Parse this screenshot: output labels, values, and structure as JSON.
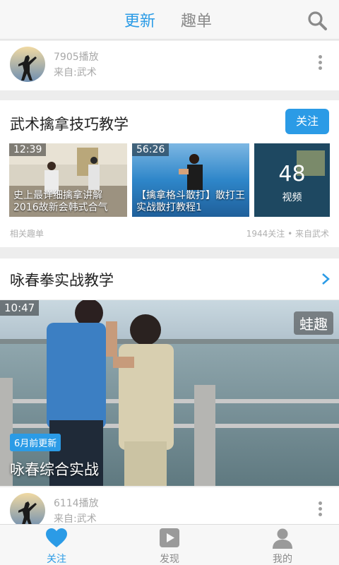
{
  "header": {
    "tabs": [
      {
        "label": "更新",
        "active": true
      },
      {
        "label": "趣单",
        "active": false
      }
    ],
    "search_icon": "search-icon",
    "accent_color": "#2b9be6"
  },
  "feed_top": {
    "plays": "7905播放",
    "source": "来自:武术"
  },
  "series": {
    "title": "武术擒拿技巧教学",
    "follow_label": "关注",
    "videos": [
      {
        "duration": "12:39",
        "caption": "史上最详细擒拿讲解2016故新会韩式合气"
      },
      {
        "duration": "56:26",
        "caption": "【擒拿格斗散打】散打王实战散打教程1"
      }
    ],
    "count": {
      "number": "48",
      "label": "视频"
    },
    "footer_left": "相关趣单",
    "footer_right": "1944关注 • 来自武术"
  },
  "wingchun": {
    "title": "咏春拳实战教学",
    "video": {
      "duration": "10:47",
      "watermark": "蛙趣",
      "badge": "6月前更新",
      "title": "咏春综合实战"
    }
  },
  "feed_bottom": {
    "plays": "6114播放",
    "source": "来自:武术"
  },
  "bottom_nav": [
    {
      "label": "关注",
      "icon": "heart-icon",
      "active": true
    },
    {
      "label": "发现",
      "icon": "play-icon",
      "active": false
    },
    {
      "label": "我的",
      "icon": "user-icon",
      "active": false
    }
  ]
}
